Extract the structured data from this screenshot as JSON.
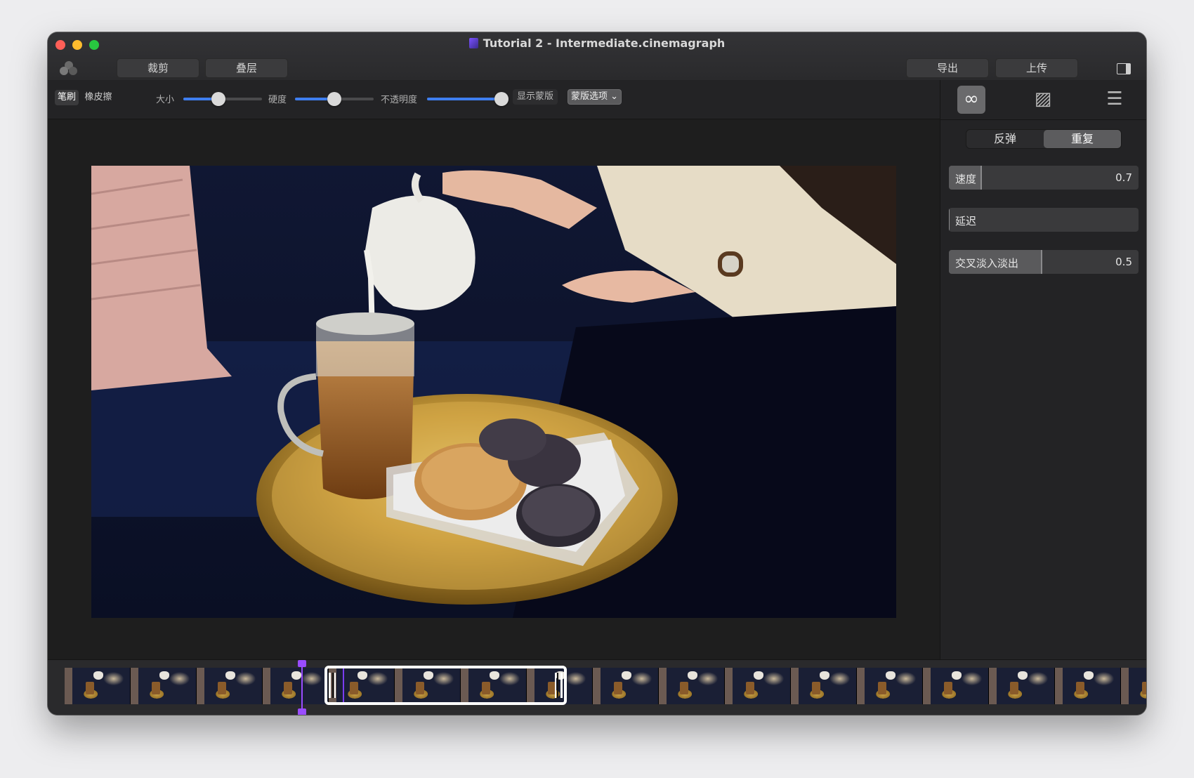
{
  "window": {
    "title": "Tutorial 2 - Intermediate.cinemagraph"
  },
  "toolbar": {
    "crop_label": "裁剪",
    "overlay_label": "叠层",
    "export_label": "导出",
    "upload_label": "上传"
  },
  "brush_bar": {
    "brush_label": "笔刷",
    "eraser_label": "橡皮擦",
    "size_label": "大小",
    "size_value": 0.45,
    "hardness_label": "硬度",
    "hardness_value": 0.5,
    "opacity_label": "不透明度",
    "opacity_value": 0.95,
    "show_mask_label": "显示蒙版",
    "mask_options_label": "蒙版选项 ⌄",
    "accent_color": "#3f7ef0"
  },
  "side_panel": {
    "tabs": [
      {
        "icon": "loop-icon",
        "glyph": "∞",
        "active": true
      },
      {
        "icon": "image-icon",
        "glyph": "▨",
        "active": false
      },
      {
        "icon": "sliders-icon",
        "glyph": "☰",
        "active": false
      }
    ],
    "loop_mode": {
      "bounce_label": "反弹",
      "repeat_label": "重复",
      "selected": "repeat"
    },
    "params": [
      {
        "label": "速度",
        "value": "0.7",
        "fraction": 0.17
      },
      {
        "label": "延迟",
        "value": "",
        "fraction": 0.0
      },
      {
        "label": "交叉淡入淡出",
        "value": "0.5",
        "fraction": 0.49
      }
    ]
  },
  "timeline": {
    "frame_count": 17,
    "playhead_color": "#9a4cff"
  }
}
